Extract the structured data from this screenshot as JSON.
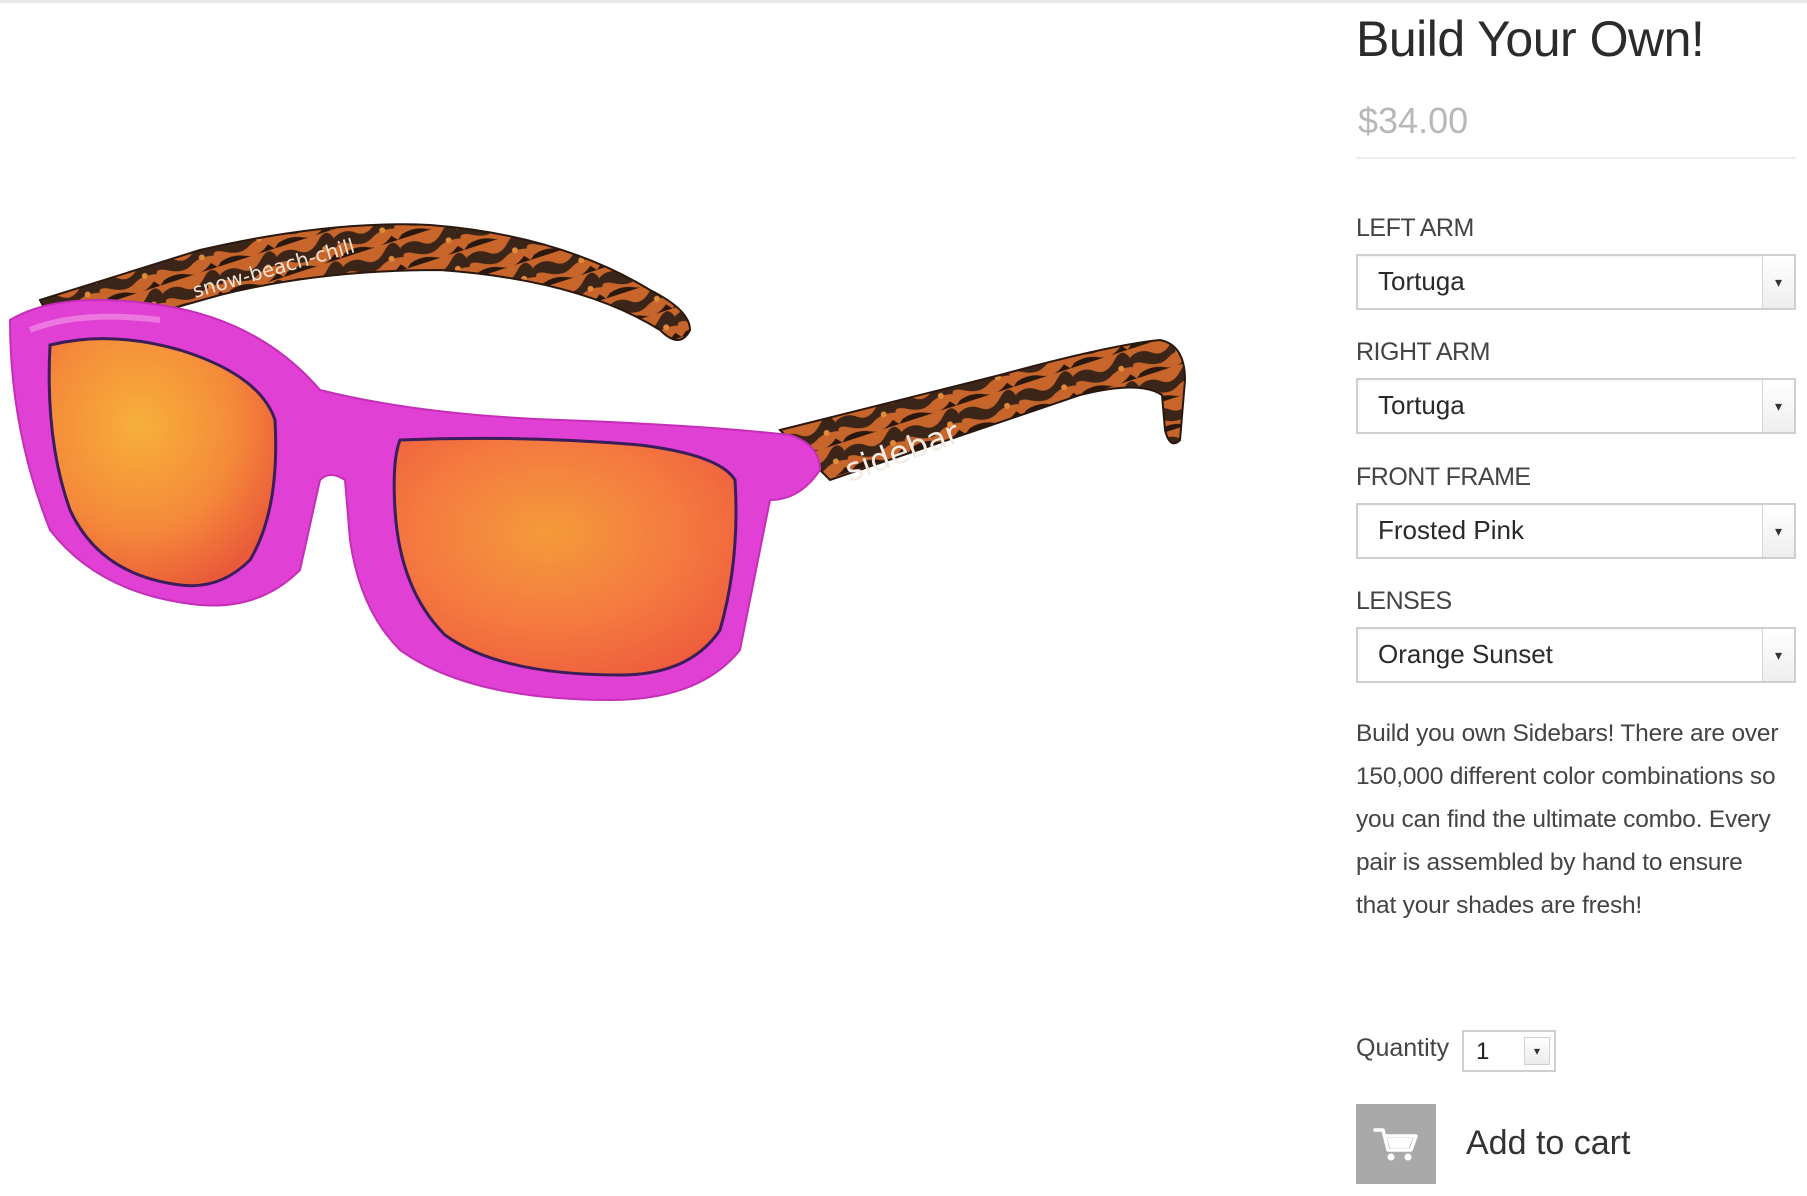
{
  "product": {
    "title": "Build Your Own!",
    "price": "$34.00",
    "image_alt_brand_left": "snow-beach-chill",
    "image_alt_brand_right": "sidebar"
  },
  "options": [
    {
      "label": "LEFT ARM",
      "value": "Tortuga"
    },
    {
      "label": "RIGHT ARM",
      "value": "Tortuga"
    },
    {
      "label": "FRONT FRAME",
      "value": "Frosted Pink"
    },
    {
      "label": "LENSES",
      "value": "Orange Sunset"
    }
  ],
  "description": "Build you own Sidebars! There are over 150,000 different color combinations so you can find the ultimate combo.  Every pair is assembled by hand to ensure that your shades are fresh!",
  "quantity": {
    "label": "Quantity",
    "value": "1"
  },
  "cart": {
    "label": "Add to cart",
    "icon": "cart-icon"
  },
  "colors": {
    "frame": "#e040d4",
    "lens_top": "#f7a23a",
    "lens_bottom": "#f2603d",
    "tortoise_dark": "#3b2418",
    "tortoise_light": "#c8652a",
    "cart_button": "#a9a9a9",
    "price": "#b8b8b8"
  }
}
